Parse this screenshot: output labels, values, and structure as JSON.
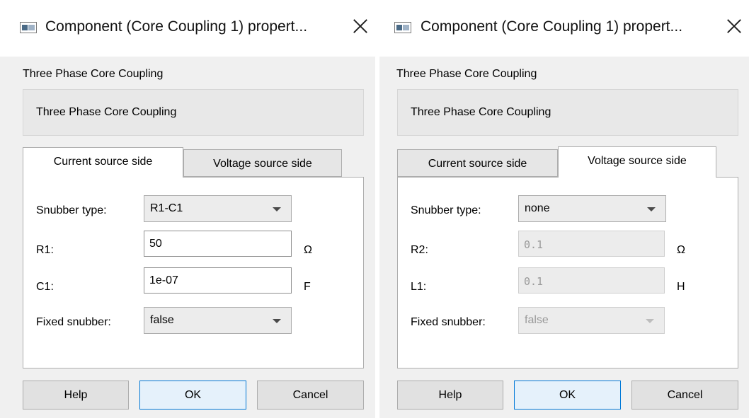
{
  "dialogs": [
    {
      "title": "Component (Core Coupling 1) propert...",
      "component_label": "Three Phase Core Coupling",
      "description": "Three Phase Core Coupling",
      "tabs": [
        "Current source side",
        "Voltage source side"
      ],
      "active_tab": "Current source side",
      "fields": {
        "snubber_type": {
          "label": "Snubber type:",
          "value": "R1-C1"
        },
        "r": {
          "label": "R1:",
          "value": "50",
          "unit": "Ω"
        },
        "second": {
          "label": "C1:",
          "value": "1e-07",
          "unit": "F"
        },
        "fixed_snubber": {
          "label": "Fixed snubber:",
          "value": "false"
        }
      },
      "buttons": {
        "help": "Help",
        "ok": "OK",
        "cancel": "Cancel"
      }
    },
    {
      "title": "Component (Core Coupling 1) propert...",
      "component_label": "Three Phase Core Coupling",
      "description": "Three Phase Core Coupling",
      "tabs": [
        "Current source side",
        "Voltage source side"
      ],
      "active_tab": "Voltage source side",
      "fields": {
        "snubber_type": {
          "label": "Snubber type:",
          "value": "none"
        },
        "r": {
          "label": "R2:",
          "value": "0.1",
          "unit": "Ω"
        },
        "second": {
          "label": "L1:",
          "value": "0.1",
          "unit": "H"
        },
        "fixed_snubber": {
          "label": "Fixed snubber:",
          "value": "false"
        }
      },
      "buttons": {
        "help": "Help",
        "ok": "OK",
        "cancel": "Cancel"
      }
    }
  ],
  "colors": {
    "accent": "#0078d7",
    "window_border": "#2b7bd6"
  },
  "icons": [
    "app-window-icon",
    "close-icon",
    "chevron-down-icon"
  ]
}
